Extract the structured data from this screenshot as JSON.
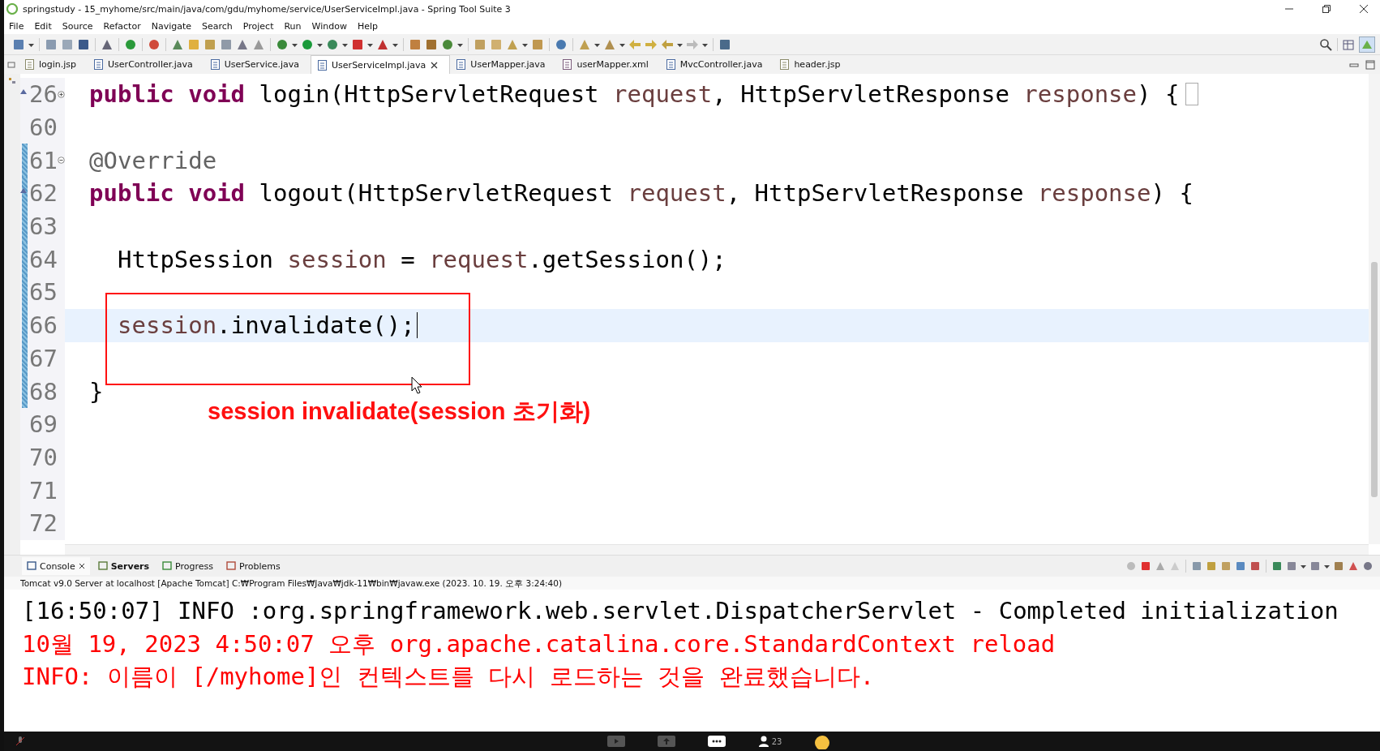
{
  "window": {
    "title": "springstudy - 15_myhome/src/main/java/com/gdu/myhome/service/UserServiceImpl.java - Spring Tool Suite 3"
  },
  "menu": [
    "File",
    "Edit",
    "Source",
    "Refactor",
    "Navigate",
    "Search",
    "Project",
    "Run",
    "Window",
    "Help"
  ],
  "editor_tabs": [
    {
      "label": "login.jsp",
      "kind": "jsp",
      "selected": false
    },
    {
      "label": "UserController.java",
      "kind": "java",
      "selected": false
    },
    {
      "label": "UserService.java",
      "kind": "java",
      "selected": false
    },
    {
      "label": "UserServiceImpl.java",
      "kind": "java",
      "selected": true
    },
    {
      "label": "UserMapper.java",
      "kind": "java",
      "selected": false
    },
    {
      "label": "userMapper.xml",
      "kind": "xml",
      "selected": false
    },
    {
      "label": "MvcController.java",
      "kind": "java",
      "selected": false
    },
    {
      "label": "header.jsp",
      "kind": "jsp",
      "selected": false
    }
  ],
  "code_lines": [
    {
      "number": "26",
      "kind": "folded",
      "override": true,
      "changed": false,
      "current": false,
      "indented": false,
      "tokens": [
        {
          "text": "public void",
          "kind": "keyword"
        },
        {
          "text": " login(HttpServletRequest ",
          "kind": "plain"
        },
        {
          "text": "request",
          "kind": "param"
        },
        {
          "text": ", HttpServletResponse ",
          "kind": "plain"
        },
        {
          "text": "response",
          "kind": "param"
        },
        {
          "text": ") {",
          "kind": "plain"
        }
      ]
    },
    {
      "number": "60",
      "kind": "code",
      "override": false,
      "changed": false,
      "current": false
    },
    {
      "number": "61",
      "kind": "foldable",
      "override": false,
      "changed": true,
      "current": false,
      "indented": false,
      "tokens": [
        {
          "text": "@Override",
          "kind": "annotation"
        }
      ]
    },
    {
      "number": "62",
      "kind": "code",
      "override": true,
      "changed": true,
      "current": false,
      "indented": false,
      "tokens": [
        {
          "text": "public void",
          "kind": "keyword"
        },
        {
          "text": " logout(HttpServletRequest ",
          "kind": "plain"
        },
        {
          "text": "request",
          "kind": "param"
        },
        {
          "text": ", HttpServletResponse ",
          "kind": "plain"
        },
        {
          "text": "response",
          "kind": "param"
        },
        {
          "text": ") {",
          "kind": "plain"
        }
      ]
    },
    {
      "number": "63",
      "kind": "code",
      "override": false,
      "changed": true,
      "current": false
    },
    {
      "number": "64",
      "kind": "code",
      "override": false,
      "changed": true,
      "current": false,
      "indented": true,
      "tokens": [
        {
          "text": "HttpSession ",
          "kind": "plain"
        },
        {
          "text": "session",
          "kind": "param"
        },
        {
          "text": " = ",
          "kind": "plain"
        },
        {
          "text": "request",
          "kind": "param"
        },
        {
          "text": ".getSession();",
          "kind": "plain"
        }
      ]
    },
    {
      "number": "65",
      "kind": "code",
      "override": false,
      "changed": true,
      "current": false
    },
    {
      "number": "66",
      "kind": "code",
      "override": false,
      "changed": true,
      "current": true,
      "indented": true,
      "tokens": [
        {
          "text": "session",
          "kind": "param"
        },
        {
          "text": ".invalidate();",
          "kind": "plain"
        }
      ]
    },
    {
      "number": "67",
      "kind": "code",
      "override": false,
      "changed": true,
      "current": false
    },
    {
      "number": "68",
      "kind": "code",
      "override": false,
      "changed": true,
      "current": false,
      "indented": false,
      "tokens": [
        {
          "text": "}",
          "kind": "plain"
        }
      ]
    },
    {
      "number": "69",
      "kind": "code",
      "override": false,
      "changed": false,
      "current": false
    },
    {
      "number": "70",
      "kind": "code",
      "override": false,
      "changed": false,
      "current": false
    },
    {
      "number": "71",
      "kind": "code",
      "override": false,
      "changed": false,
      "current": false
    },
    {
      "number": "72",
      "kind": "code",
      "override": false,
      "changed": false,
      "current": false
    }
  ],
  "annotation": {
    "caption": "session invalidate(session 초기화)"
  },
  "console": {
    "tabs": [
      {
        "label": "Console",
        "kind": "console",
        "selected": true,
        "bold": false
      },
      {
        "label": "Servers",
        "kind": "servers",
        "selected": false,
        "bold": true
      },
      {
        "label": "Progress",
        "kind": "progress",
        "selected": false,
        "bold": false
      },
      {
        "label": "Problems",
        "kind": "problems",
        "selected": false,
        "bold": false
      }
    ],
    "description": "Tomcat v9.0 Server at localhost [Apache Tomcat] C:₩Program Files₩Java₩jdk-11₩bin₩javaw.exe  (2023. 10. 19. 오후 3:24:40)",
    "lines": [
      {
        "text": "[16:50:07] INFO :org.springframework.web.servlet.DispatcherServlet - Completed initialization",
        "kind": "out"
      },
      {
        "text": "10월 19, 2023 4:50:07 오후 org.apache.catalina.core.StandardContext reload",
        "kind": "err"
      },
      {
        "text": "INFO: 이름이 [/myhome]인 컨텍스트를 다시 로드하는 것을 완료했습니다.",
        "kind": "err"
      }
    ]
  },
  "meeting_bar": {
    "participants": "23"
  }
}
